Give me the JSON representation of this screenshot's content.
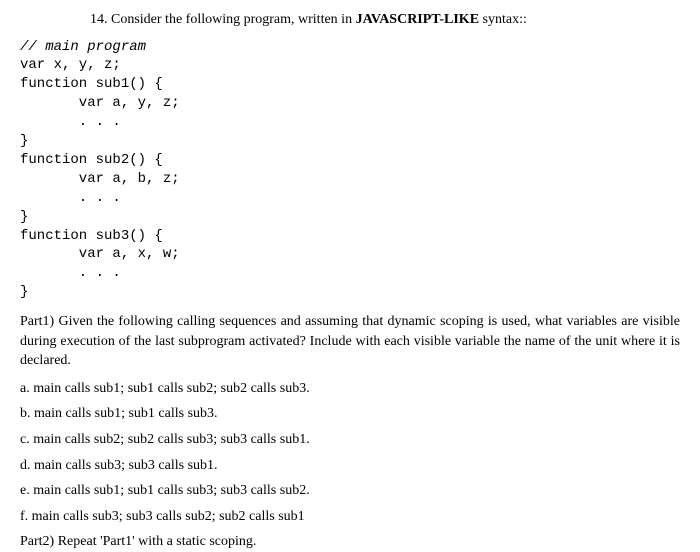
{
  "question": {
    "number": "14.",
    "intro_before": " Consider the following program, written in ",
    "bold_text": "JAVASCRIPT-LIKE",
    "intro_after": " syntax::"
  },
  "code": {
    "comment": "// main program",
    "line1": "var x, y, z;",
    "line2": "function sub1() {",
    "line3": "       var a, y, z;",
    "line4": "       . . .",
    "line5": "}",
    "line6": "function sub2() {",
    "line7": "       var a, b, z;",
    "line8": "       . . .",
    "line9": "}",
    "line10": "function sub3() {",
    "line11": "       var a, x, w;",
    "line12": "       . . .",
    "line13": "}"
  },
  "part1": {
    "text": "Part1) Given the following calling sequences and assuming that dynamic scoping is used, what variables are visible during execution of the last subprogram activated?  Include with each visible variable the name of the unit where it is declared."
  },
  "items": {
    "a": "a. main calls sub1; sub1 calls sub2; sub2 calls sub3.",
    "b": "b. main calls sub1; sub1 calls sub3.",
    "c": "c. main calls sub2; sub2 calls sub3; sub3 calls sub1.",
    "d": "d. main calls sub3; sub3 calls sub1.",
    "e": "e. main calls sub1; sub1 calls sub3; sub3 calls sub2.",
    "f": "f. main calls sub3; sub3 calls sub2; sub2 calls sub1"
  },
  "part2": {
    "text": "Part2) Repeat 'Part1' with a static scoping."
  }
}
